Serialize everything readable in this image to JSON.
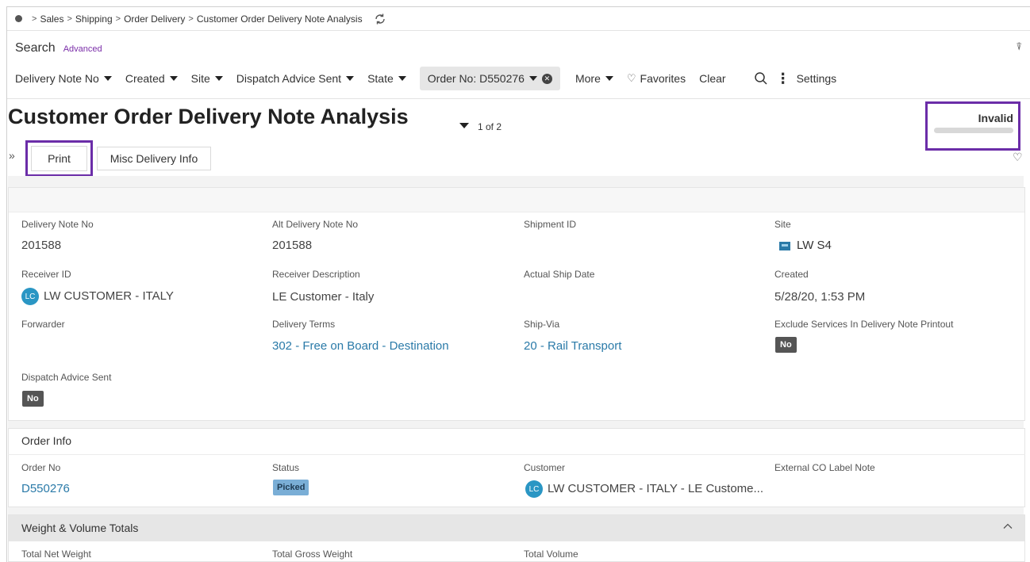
{
  "breadcrumb": {
    "items": [
      "Sales",
      "Shipping",
      "Order Delivery",
      "Customer Order Delivery Note Analysis"
    ]
  },
  "search": {
    "label": "Search",
    "advanced": "Advanced",
    "filters": [
      {
        "label": "Delivery Note No"
      },
      {
        "label": "Created"
      },
      {
        "label": "Site"
      },
      {
        "label": "Dispatch Advice Sent"
      },
      {
        "label": "State"
      }
    ],
    "active_filter": "Order No: D550276",
    "more": "More",
    "favorites": "Favorites",
    "clear": "Clear",
    "settings": "Settings"
  },
  "page": {
    "title": "Customer Order Delivery Note Analysis",
    "record_count": "1 of 2",
    "status": "Invalid"
  },
  "toolbar": {
    "print": "Print",
    "misc": "Misc Delivery Info"
  },
  "details": {
    "delivery_note_no_label": "Delivery Note No",
    "delivery_note_no": "201588",
    "alt_delivery_note_no_label": "Alt Delivery Note No",
    "alt_delivery_note_no": "201588",
    "shipment_id_label": "Shipment ID",
    "site_label": "Site",
    "site": "LW S4",
    "receiver_id_label": "Receiver ID",
    "receiver_id": "LW CUSTOMER - ITALY",
    "receiver_avatar": "LC",
    "receiver_description_label": "Receiver Description",
    "receiver_description": "LE Customer - Italy",
    "actual_ship_date_label": "Actual Ship Date",
    "created_label": "Created",
    "created": "5/28/20, 1:53 PM",
    "forwarder_label": "Forwarder",
    "delivery_terms_label": "Delivery Terms",
    "delivery_terms": "302 - Free on Board - Destination",
    "ship_via_label": "Ship-Via",
    "ship_via": "20 - Rail Transport",
    "exclude_services_label": "Exclude Services In Delivery Note Printout",
    "exclude_services": "No",
    "dispatch_advice_label": "Dispatch Advice Sent",
    "dispatch_advice": "No"
  },
  "order_info": {
    "title": "Order Info",
    "order_no_label": "Order No",
    "order_no": "D550276",
    "status_label": "Status",
    "status": "Picked",
    "customer_label": "Customer",
    "customer_avatar": "LC",
    "customer": "LW CUSTOMER - ITALY - LE Custome...",
    "external_label": "External CO Label Note"
  },
  "weight_volume": {
    "title": "Weight & Volume Totals",
    "net_weight_label": "Total Net Weight",
    "gross_weight_label": "Total Gross Weight",
    "volume_label": "Total Volume"
  },
  "colors": {
    "accent_purple": "#6b2da8",
    "link_blue": "#2a7aa8",
    "avatar_blue": "#2a96c4",
    "picked_badge": "#7aaed6"
  }
}
